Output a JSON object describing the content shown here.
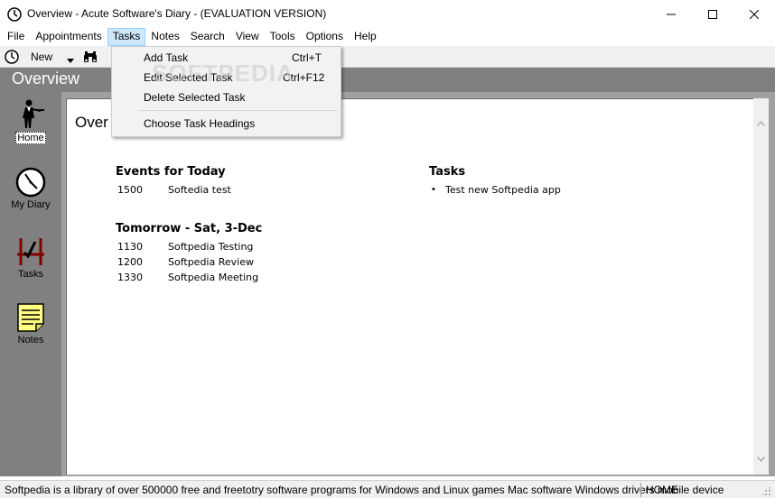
{
  "window": {
    "title": "Overview - Acute Software's Diary - (EVALUATION VERSION)"
  },
  "menubar": {
    "items": [
      "File",
      "Appointments",
      "Tasks",
      "Notes",
      "Search",
      "View",
      "Tools",
      "Options",
      "Help"
    ],
    "open_menu": "Tasks"
  },
  "toolbar": {
    "new_label": "New"
  },
  "header": {
    "title": "Overview"
  },
  "sidebar": {
    "items": [
      {
        "label": "Home",
        "icon": "waiter-icon",
        "active": true
      },
      {
        "label": "My Diary",
        "icon": "clock-icon",
        "active": false
      },
      {
        "label": "Tasks",
        "icon": "tasks-icon",
        "active": false
      },
      {
        "label": "Notes",
        "icon": "notes-icon",
        "active": false
      }
    ]
  },
  "main": {
    "heading": "Over",
    "events_today": {
      "title": "Events for Today",
      "rows": [
        {
          "time": "1500",
          "desc": "Softedia test"
        }
      ]
    },
    "tomorrow": {
      "title": "Tomorrow - Sat, 3-Dec",
      "rows": [
        {
          "time": "1130",
          "desc": "Softpedia Testing"
        },
        {
          "time": "1200",
          "desc": "Softpedia Review"
        },
        {
          "time": "1330",
          "desc": "Softpedia Meeting"
        }
      ]
    },
    "tasks": {
      "title": "Tasks",
      "items": [
        "Test new Softpedia app"
      ]
    }
  },
  "dropdown": {
    "items": [
      {
        "label": "Add Task",
        "shortcut": "Ctrl+T"
      },
      {
        "label": "Edit Selected Task",
        "shortcut": "Ctrl+F12"
      },
      {
        "label": "Delete Selected Task",
        "shortcut": ""
      },
      {
        "label": "Choose Task Headings",
        "shortcut": ""
      }
    ]
  },
  "watermark": "SOFTPEDIA",
  "statusbar": {
    "message": "Softpedia is a library of over 500000 free and freetotry software programs for Windows and Linux games Mac software Windows drivers mobile device",
    "mode": "HOME"
  },
  "colors": {
    "sidebar_bg": "#808080",
    "menu_highlight": "#cce8ff",
    "notes_yellow": "#ffff80"
  }
}
